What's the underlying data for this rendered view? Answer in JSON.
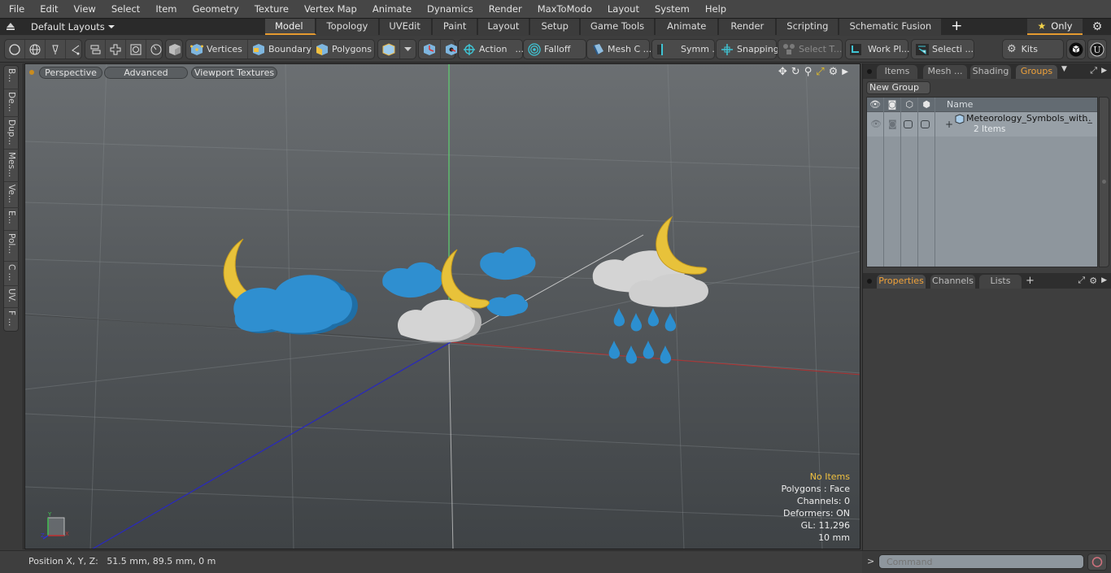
{
  "menubar": [
    "File",
    "Edit",
    "View",
    "Select",
    "Item",
    "Geometry",
    "Texture",
    "Vertex Map",
    "Animate",
    "Dynamics",
    "Render",
    "MaxToModo",
    "Layout",
    "System",
    "Help"
  ],
  "layout_selector": {
    "label": "Default Layouts"
  },
  "layout_tabs": [
    {
      "label": "Model",
      "active": true
    },
    {
      "label": "Topology"
    },
    {
      "label": "UVEdit"
    },
    {
      "label": "Paint"
    },
    {
      "label": "Layout"
    },
    {
      "label": "Setup"
    },
    {
      "label": "Game Tools"
    },
    {
      "label": "Animate"
    },
    {
      "label": "Render"
    },
    {
      "label": "Scripting"
    },
    {
      "label": "Schematic Fusion"
    }
  ],
  "add_tab_label": "+",
  "only_button": {
    "label": "Only",
    "icon": "star-icon"
  },
  "toolbar": {
    "vertices": "Vertices",
    "boundary": "Boundary",
    "polygons": "Polygons",
    "action": "Action",
    "falloff": "Falloff",
    "mesh_c": "Mesh C ...",
    "symm": "Symm ...",
    "snapping": "Snapping",
    "select_t": "Select T...",
    "work_pl": "Work Pl...",
    "selecti": "Selecti ...",
    "kits": "Kits",
    "ellipsis": "..."
  },
  "left_tabs": [
    "B...",
    "De...",
    "Dup...",
    "Mes...",
    "Ve...",
    "E...",
    "Pol...",
    "C ...",
    "UV.",
    "F ..."
  ],
  "viewport": {
    "buttons": {
      "perspective": "Perspective",
      "advanced": "Advanced",
      "textures": "Viewport Textures"
    },
    "stats": {
      "selection": "No Items",
      "polygons": "Polygons : Face",
      "channels": "Channels: 0",
      "deformers": "Deformers: ON",
      "gl": "GL: 11,296",
      "unit": "10 mm"
    },
    "axis_labels": {
      "x": "X",
      "y": "Y",
      "z": "Z"
    },
    "colors": {
      "moon": "#e8c23a",
      "cloud_blue": "#2f8fd0",
      "cloud_gray": "#d4d4d4",
      "rain": "#2c8fd0",
      "x_axis": "#b03030",
      "y_axis": "#5fd070",
      "z_axis": "#2a2ab8"
    }
  },
  "status": {
    "position_label": "Position X, Y, Z:",
    "position_value": "51.5 mm, 89.5 mm, 0 m"
  },
  "right_panel": {
    "top_tabs": [
      {
        "label": "Items"
      },
      {
        "label": "Mesh ..."
      },
      {
        "label": "Shading"
      },
      {
        "label": "Groups",
        "active": true
      }
    ],
    "new_group": "New Group",
    "list_header": {
      "name": "Name"
    },
    "group": {
      "name": "Meteorology_Symbols_with_",
      "ellipsis": "...",
      "count": "2 Items",
      "expand": "+"
    },
    "bottom_tabs": [
      {
        "label": "Properties",
        "active": true
      },
      {
        "label": "Channels"
      },
      {
        "label": "Lists"
      }
    ],
    "add_tab": "+"
  },
  "command": {
    "prompt": ">",
    "placeholder": "Command"
  },
  "accent_color": "#e59a2f"
}
